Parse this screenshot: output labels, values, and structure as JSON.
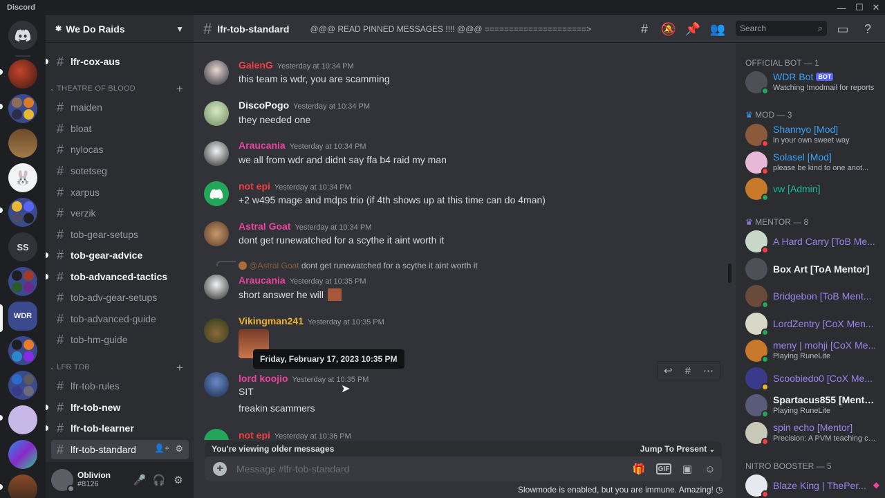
{
  "titlebar": {
    "app_name": "Discord"
  },
  "guild": {
    "name": "We Do Raids"
  },
  "channel_list": {
    "top_channel": "lfr-cox-aus",
    "categories": [
      {
        "name": "THEATRE OF BLOOD"
      },
      {
        "name": "LFR TOB"
      }
    ],
    "tob_channels": [
      "maiden",
      "bloat",
      "nylocas",
      "sotetseg",
      "xarpus",
      "verzik",
      "tob-gear-setups",
      "tob-gear-advice",
      "tob-advanced-tactics",
      "tob-adv-gear-setups",
      "tob-advanced-guide",
      "tob-hm-guide"
    ],
    "lfr_channels": [
      "lfr-tob-rules",
      "lfr-tob-new",
      "lfr-tob-learner",
      "lfr-tob-standard"
    ]
  },
  "server_list": {
    "ss_label": "SS"
  },
  "user": {
    "name": "Oblivion",
    "tag": "#8126"
  },
  "header": {
    "channel_name": "lfr-tob-standard",
    "topic": "@@@ READ PINNED MESSAGES !!!! @@@ =====================>",
    "search_placeholder": "Search"
  },
  "messages": [
    {
      "author": "GalenG",
      "color": "#f23f43",
      "time": "Yesterday at 10:34 PM",
      "text": "this team is wdr, you are scamming"
    },
    {
      "author": "DiscoPogo",
      "color": "#f2f3f5",
      "time": "Yesterday at 10:34 PM",
      "text": "they needed one"
    },
    {
      "author": "Araucania",
      "color": "#eb459f",
      "time": "Yesterday at 10:34 PM",
      "text": "we all from wdr and didnt say ffa b4 raid my man"
    },
    {
      "author": "not epi",
      "color": "#f23f43",
      "time": "Yesterday at 10:34 PM",
      "text": "+2 w495 mage and mdps trio (if 4th shows up at this time can do 4man)"
    },
    {
      "author": "Astral Goat",
      "color": "#eb459f",
      "time": "Yesterday at 10:34 PM",
      "text": "dont get runewatched for a scythe it aint worth it"
    },
    {
      "author": "Araucania",
      "color": "#eb459f",
      "time": "Yesterday at 10:35 PM",
      "text": "short answer he will",
      "reply_author": "@Astral Goat",
      "reply_text": "dont get runewatched for a scythe it aint worth it"
    },
    {
      "author": "Vikingman241",
      "color": "#f0b232",
      "time": "Yesterday at 10:35 PM",
      "text": ""
    },
    {
      "author": "lord koojio",
      "color": "#eb459f",
      "time": "Yesterday at 10:35 PM",
      "text": "SIT",
      "text2": "freakin scammers"
    },
    {
      "author": "not epi",
      "color": "#f23f43",
      "time": "Yesterday at 10:36 PM",
      "text": ""
    }
  ],
  "tooltip": "Friday, February 17, 2023 10:35 PM",
  "older_banner": {
    "label": "You're viewing older messages",
    "jump": "Jump To Present"
  },
  "composer": {
    "placeholder": "Message #lfr-tob-standard",
    "gif": "GIF"
  },
  "slowmode": "Slowmode is enabled, but you are immune. Amazing!",
  "members": {
    "roles": [
      "OFFICIAL BOT — 1",
      "MOD — 3",
      "MENTOR — 8",
      "NITRO BOOSTER — 5"
    ],
    "bot": {
      "name": "WDR Bot",
      "badge": "BOT",
      "activity": "Watching !modmail for reports"
    },
    "mods": [
      {
        "name": "Shannyo [Mod]",
        "activity": "in your own sweet way",
        "color": "#3ba0f5"
      },
      {
        "name": "Solasel [Mod]",
        "activity": "please be kind to one anot...",
        "color": "#3ba0f5"
      },
      {
        "name": "vw [Admin]",
        "activity": "",
        "color": "#1abc9c"
      }
    ],
    "mentors": [
      {
        "name": "A Hard Carry [ToB Me...",
        "activity": "",
        "color": "#9b84ec"
      },
      {
        "name": "Box Art [ToA Mentor]",
        "activity": "",
        "color": "#f2f3f5"
      },
      {
        "name": "Bridgebon [ToB Ment...",
        "activity": "",
        "color": "#9b84ec"
      },
      {
        "name": "LordZentry [CoX Men...",
        "activity": "",
        "color": "#9b84ec"
      },
      {
        "name": "meny | mohji [CoX Me...",
        "activity": "Playing RuneLite",
        "color": "#9b84ec"
      },
      {
        "name": "Scoobiedo0 [CoX Me...",
        "activity": "",
        "color": "#9b84ec"
      },
      {
        "name": "Spartacus855 [Mento...",
        "activity": "Playing RuneLite",
        "color": "#f2f3f5"
      },
      {
        "name": "spin echo [Mentor]",
        "activity": "Precision: A PVM teaching clan",
        "color": "#9b84ec"
      }
    ],
    "boosters": [
      {
        "name": "Blaze King | ThePer...",
        "activity": "",
        "color": "#9b84ec"
      }
    ]
  }
}
